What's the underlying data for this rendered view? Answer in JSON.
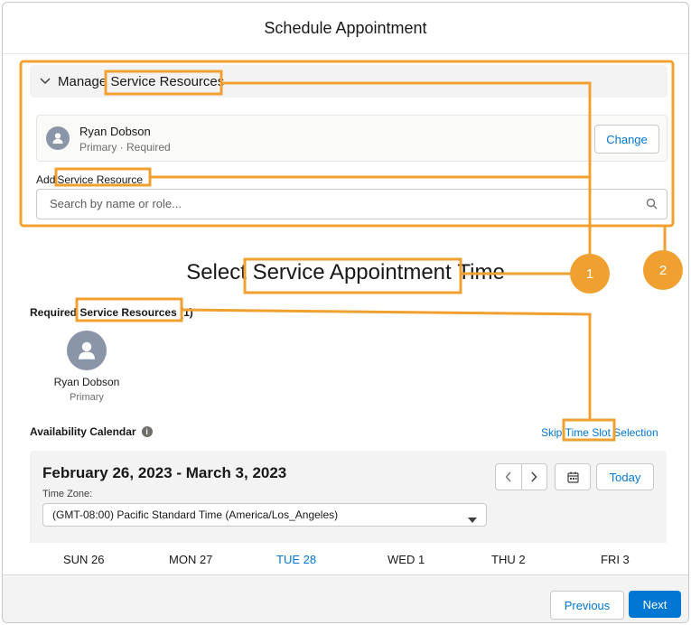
{
  "modal": {
    "title": "Schedule Appointment"
  },
  "manage": {
    "prefix": "Manage",
    "highlight": "Service Resources",
    "resource": {
      "name": "Ryan Dobson",
      "subtitle": "Primary · Required",
      "change_label": "Change"
    },
    "add_prefix": "Add",
    "add_highlight": "Service Resource",
    "search_placeholder": "Search by name or role..."
  },
  "select": {
    "title_prefix": "Select",
    "title_highlight": "Service Appointment",
    "title_suffix": "Time",
    "required_prefix": "Required",
    "required_highlight": "Service Resources",
    "required_count": "(1)",
    "resource": {
      "name": "Ryan Dobson",
      "role": "Primary"
    }
  },
  "availability": {
    "label": "Availability Calendar",
    "info_icon": "i",
    "skip_prefix": "Skip",
    "skip_highlight": "Time Slot",
    "skip_suffix": "Selection",
    "date_range": "February 26, 2023 - March 3, 2023",
    "timezone_label": "Time Zone:",
    "timezone_value": "(GMT-08:00) Pacific Standard Time (America/Los_Angeles)",
    "today_label": "Today",
    "days": [
      "SUN 26",
      "MON 27",
      "TUE 28",
      "WED 1",
      "THU 2",
      "FRI 3"
    ],
    "active_day": "TUE 28"
  },
  "footer": {
    "previous_label": "Previous",
    "next_label": "Next"
  },
  "annotations": {
    "badge_1": "1",
    "badge_2": "2"
  },
  "colors": {
    "brand_blue": "#0176d3",
    "annotation_orange": "#f0a030",
    "panel_gray": "#f3f3f3"
  }
}
